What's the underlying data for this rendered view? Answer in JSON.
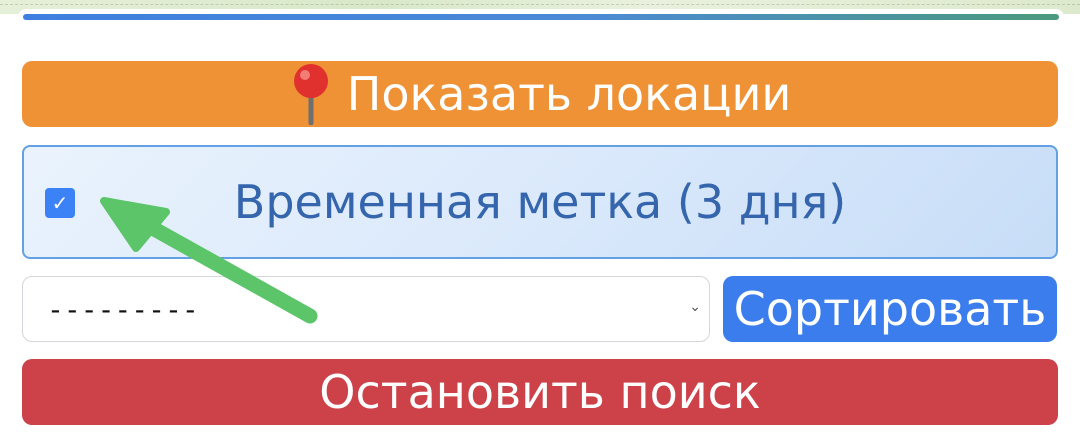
{
  "progress": {
    "value_percent": 100,
    "color_start": "#3e7fe0",
    "color_end": "#4a9a7c"
  },
  "show_locations_button": {
    "label": "Показать локации",
    "icon": "map-pin-icon",
    "color": "#ef9236"
  },
  "temporary_mark": {
    "label": "Временная метка (3 дня)",
    "checked": true,
    "check_glyph": "✓"
  },
  "sort_select": {
    "selected": "---------"
  },
  "sort_button": {
    "label": "Сортировать",
    "color": "#3b7ded"
  },
  "stop_button": {
    "label": "Остановить поиск",
    "color": "#cd4149"
  },
  "annotation": {
    "icon": "arrow-annotation-icon",
    "color": "#5cc56a"
  }
}
